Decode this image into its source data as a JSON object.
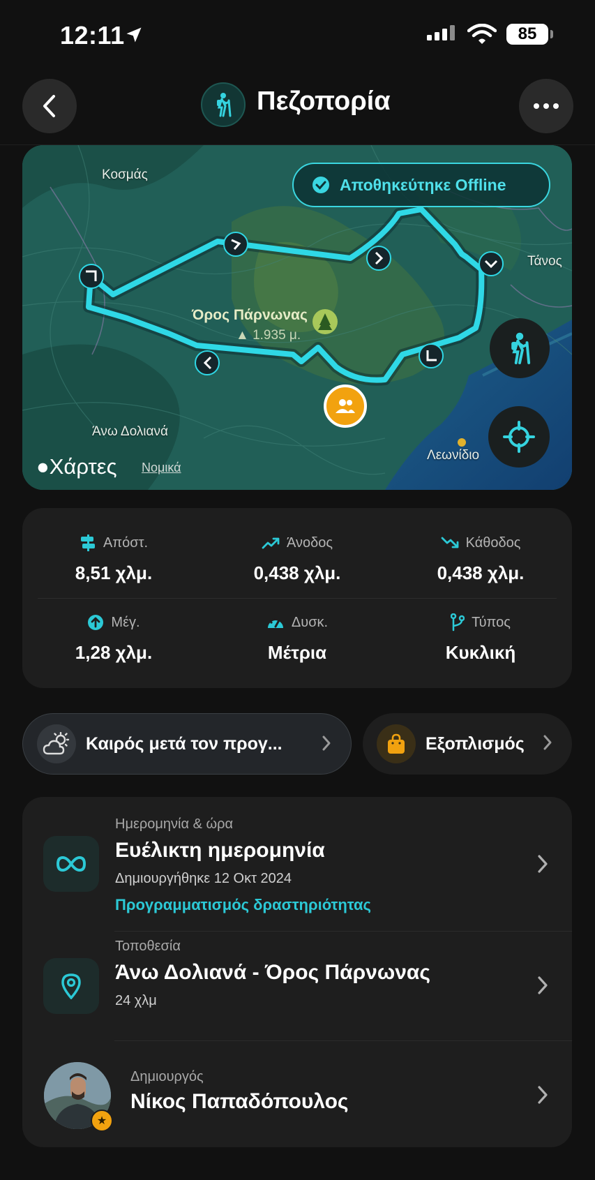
{
  "status_bar": {
    "time": "12:11",
    "battery": "85"
  },
  "header": {
    "title": "Πεζοπορία",
    "title_icon": "hiker-icon"
  },
  "map": {
    "offline_badge": "Αποθηκεύτηκε Offline",
    "labels": {
      "kosmas": "Κοσμάς",
      "tanos": "Τάνος",
      "ano_doliana": "Άνω Δολιανά",
      "leonidio": "Λεωνίδιο"
    },
    "peak_name": "Όρος Πάρνωνας",
    "peak_elevation": "▲ 1.935 μ.",
    "brand": "Χάρτες",
    "legal": "Νομικά",
    "route_color": "#2fd8e6"
  },
  "stats": [
    {
      "label": "Απόστ.",
      "value": "8,51 χλμ.",
      "icon": "signpost-icon"
    },
    {
      "label": "Άνοδος",
      "value": "0,438 χλμ.",
      "icon": "trend-up-icon"
    },
    {
      "label": "Κάθοδος",
      "value": "0,438 χλμ.",
      "icon": "trend-down-icon"
    },
    {
      "label": "Μέγ.",
      "value": "1,28 χλμ.",
      "icon": "arrow-up-circle-icon"
    },
    {
      "label": "Δυσκ.",
      "value": "Μέτρια",
      "icon": "gauge-icon"
    },
    {
      "label": "Τύπος",
      "value": "Κυκλική",
      "icon": "branch-icon"
    }
  ],
  "pills": {
    "weather": "Καιρός μετά τον προγ...",
    "gear": "Εξοπλισμός"
  },
  "details": {
    "date": {
      "label": "Ημερομηνία & ώρα",
      "title": "Ευέλικτη ημερομηνία",
      "subtitle": "Δημιουργήθηκε 12 Οκτ 2024",
      "link": "Προγραμματισμός δραστηριότητας"
    },
    "location": {
      "label": "Τοποθεσία",
      "title": "Άνω Δολιανά - Όρος Πάρνωνας",
      "subtitle": "24 χλμ"
    },
    "creator": {
      "label": "Δημιουργός",
      "title": "Νίκος Παπαδόπουλος"
    }
  },
  "colors": {
    "accent": "#2cc9d6",
    "orange": "#f2a20f",
    "card": "#1e1e1e"
  }
}
